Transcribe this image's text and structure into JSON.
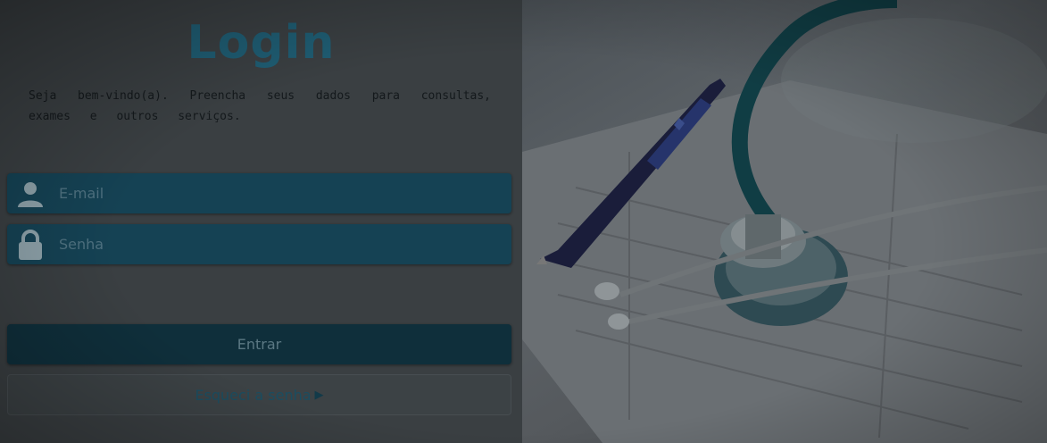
{
  "login": {
    "title": "Login",
    "intro": "Seja bem-vindo(a). Preencha seus dados para consultas, exames e outros serviços.",
    "email_placeholder": "E-mail",
    "password_placeholder": "Senha",
    "submit_label": "Entrar",
    "forgot_label": "Esqueci a senha",
    "user_icon": "user-icon",
    "lock_icon": "lock-icon",
    "forgot_icon": "arrow-right-icon"
  },
  "hero": {
    "image": "stethoscope-and-pen-on-medical-form-photo"
  },
  "colors": {
    "accent": "#1f5d73",
    "field_bg": "#154254",
    "button_bg": "#0f2f3b",
    "overlay": "#2a2e31"
  }
}
